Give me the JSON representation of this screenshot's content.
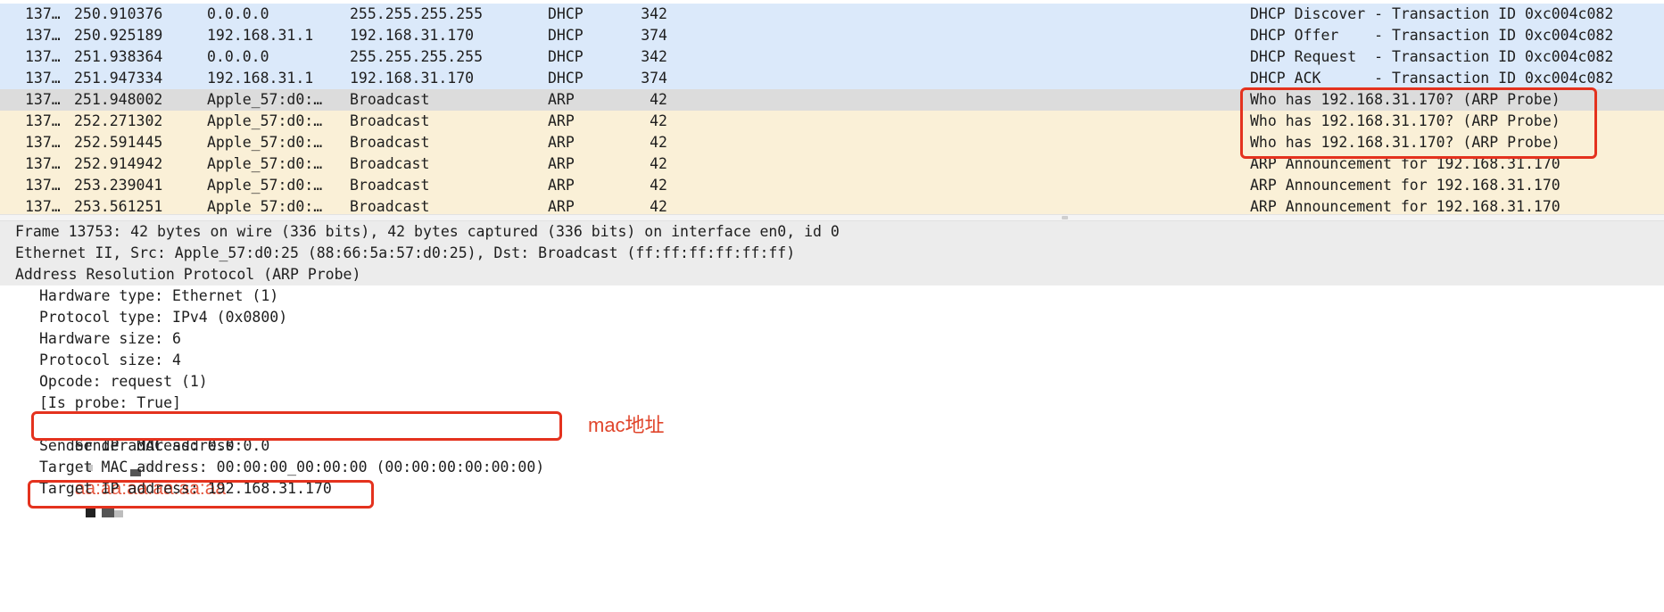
{
  "packet_list": {
    "rows": [
      {
        "no": "137…",
        "time": "250.910376",
        "src": "0.0.0.0",
        "dst": "255.255.255.255",
        "proto": "DHCP",
        "len": "342",
        "info": "DHCP Discover - Transaction ID 0xc004c082"
      },
      {
        "no": "137…",
        "time": "250.925189",
        "src": "192.168.31.1",
        "dst": "192.168.31.170",
        "proto": "DHCP",
        "len": "374",
        "info": "DHCP Offer    - Transaction ID 0xc004c082"
      },
      {
        "no": "137…",
        "time": "251.938364",
        "src": "0.0.0.0",
        "dst": "255.255.255.255",
        "proto": "DHCP",
        "len": "342",
        "info": "DHCP Request  - Transaction ID 0xc004c082"
      },
      {
        "no": "137…",
        "time": "251.947334",
        "src": "192.168.31.1",
        "dst": "192.168.31.170",
        "proto": "DHCP",
        "len": "374",
        "info": "DHCP ACK      - Transaction ID 0xc004c082"
      },
      {
        "no": "137…",
        "time": "251.948002",
        "src": "Apple_57:d0:…",
        "dst": "Broadcast",
        "proto": "ARP",
        "len": "42",
        "info": "Who has 192.168.31.170? (ARP Probe)"
      },
      {
        "no": "137…",
        "time": "252.271302",
        "src": "Apple_57:d0:…",
        "dst": "Broadcast",
        "proto": "ARP",
        "len": "42",
        "info": "Who has 192.168.31.170? (ARP Probe)"
      },
      {
        "no": "137…",
        "time": "252.591445",
        "src": "Apple_57:d0:…",
        "dst": "Broadcast",
        "proto": "ARP",
        "len": "42",
        "info": "Who has 192.168.31.170? (ARP Probe)"
      },
      {
        "no": "137…",
        "time": "252.914942",
        "src": "Apple_57:d0:…",
        "dst": "Broadcast",
        "proto": "ARP",
        "len": "42",
        "info": "ARP Announcement for 192.168.31.170"
      },
      {
        "no": "137…",
        "time": "253.239041",
        "src": "Apple_57:d0:…",
        "dst": "Broadcast",
        "proto": "ARP",
        "len": "42",
        "info": "ARP Announcement for 192.168.31.170"
      },
      {
        "no": "137…",
        "time": "253.561251",
        "src": "Apple_57:d0:…",
        "dst": "Broadcast",
        "proto": "ARP",
        "len": "42",
        "info": "ARP Announcement for 192.168.31.170"
      }
    ],
    "selected_row": 4,
    "colors": {
      "dhcp_row": "#dbe9fa",
      "arp_row": "#faf0d7",
      "selected_row": "#dcdcdc"
    }
  },
  "details": {
    "frame": "Frame 13753: 42 bytes on wire (336 bits), 42 bytes captured (336 bits) on interface en0, id 0",
    "ethernet": "Ethernet II, Src: Apple_57:d0:25 (88:66:5a:57:d0:25), Dst: Broadcast (ff:ff:ff:ff:ff:ff)",
    "arp": "Address Resolution Protocol (ARP Probe)",
    "fields": {
      "hardware_type": "Hardware type: Ethernet (1)",
      "protocol_type": "Protocol type: IPv4 (0x0800)",
      "hardware_size": "Hardware size: 6",
      "protocol_size": "Protocol size: 4",
      "opcode": "Opcode: request (1)",
      "is_probe": "[Is probe: True]",
      "sender_mac_label": "Sender MAC address: ",
      "sender_mac_value": "aa:aa:aa:aa:aa:aa",
      "sender_ip": "Sender IP address: 0.0.0.0",
      "target_mac": "Target MAC address: 00:00:00_00:00:00 (00:00:00:00:00:00)",
      "target_ip": "Target IP address: 192.168.31.170"
    }
  },
  "annotation": {
    "note": "mac地址",
    "color": "#e4321e"
  }
}
